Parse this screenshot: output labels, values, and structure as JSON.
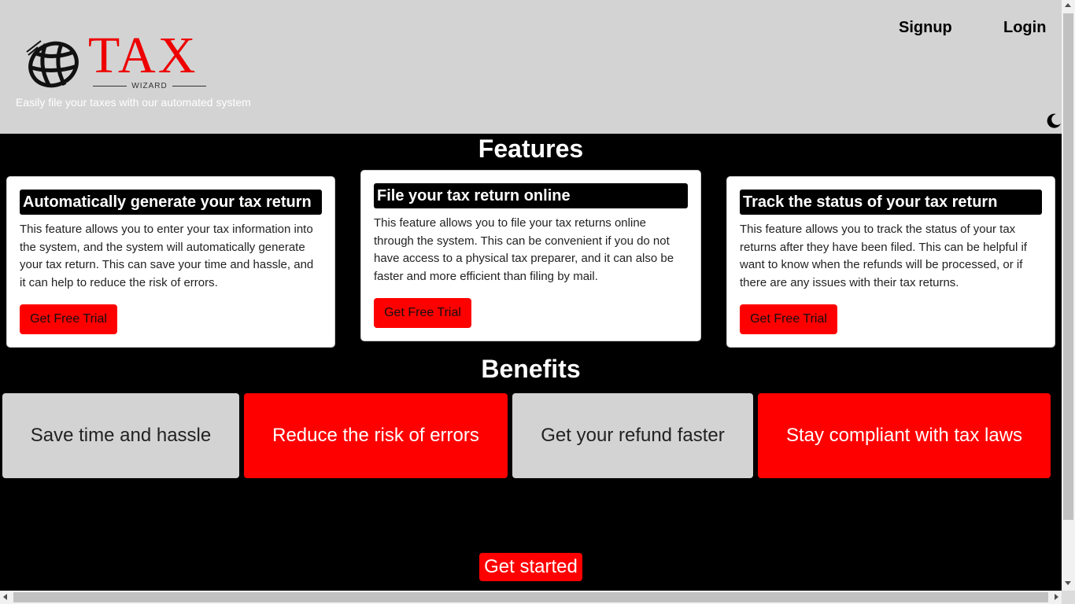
{
  "header": {
    "logo": {
      "brand": "TAX",
      "sub": "WIZARD",
      "icon": "globe-icon"
    },
    "tagline": "Easily file your taxes with our automated system",
    "nav": {
      "signup": "Signup",
      "login": "Login"
    },
    "theme_toggle_icon": "moon-icon"
  },
  "features": {
    "title": "Features",
    "cards": [
      {
        "title": "Automatically generate your tax return",
        "description": "This feature allows you to enter your tax information into the system, and the system will automatically generate your tax return. This can save your time and hassle, and it can help to reduce the risk of errors.",
        "button": "Get Free Trial"
      },
      {
        "title": "File your tax return online",
        "description": "This feature allows you to file your tax returns online through the system. This can be convenient if you do not have access to a physical tax preparer, and it can also be faster and more efficient than filing by mail.",
        "button": "Get Free Trial"
      },
      {
        "title": "Track the status of your tax return",
        "description": "This feature allows you to track the status of your tax returns after they have been filed. This can be helpful if want to know when the refunds will be processed, or if there are any issues with their tax returns.",
        "button": "Get Free Trial"
      }
    ]
  },
  "benefits": {
    "title": "Benefits",
    "items": [
      "Save time and hassle",
      "Reduce the risk of errors",
      "Get your refund faster",
      "Stay compliant with tax laws"
    ]
  },
  "cta": {
    "label": "Get started"
  },
  "colors": {
    "accent": "#ff0000",
    "header_bg": "#d3d3d3",
    "page_bg": "#000000",
    "card_bg": "#ffffff"
  }
}
